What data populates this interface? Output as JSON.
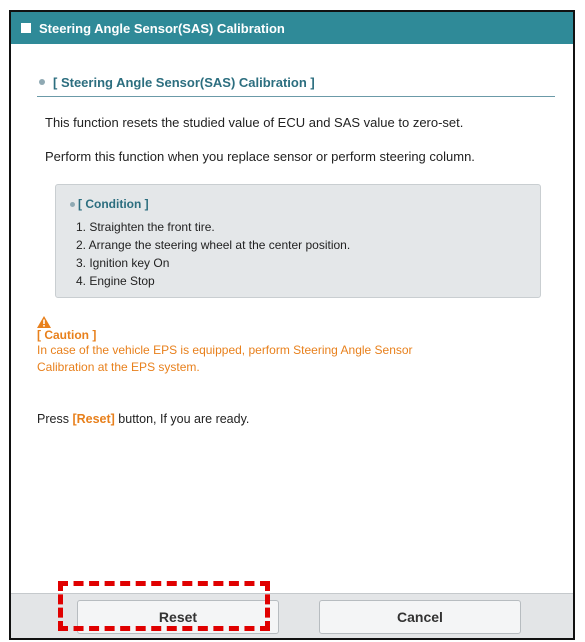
{
  "window": {
    "title": "Steering Angle Sensor(SAS) Calibration"
  },
  "section": {
    "header": "[ Steering Angle Sensor(SAS) Calibration ]",
    "desc1": "This function resets the studied value of ECU and SAS value to zero-set.",
    "desc2": "Perform this function when you replace sensor or perform steering column."
  },
  "condition": {
    "title": "[ Condition ]",
    "items": [
      "1. Straighten the front tire.",
      "2. Arrange the steering wheel at the center position.",
      "3. Ignition key On",
      "4. Engine Stop"
    ]
  },
  "caution": {
    "icon": "warning-icon",
    "title": "[ Caution ]",
    "text": "In case of the vehicle EPS is equipped, perform Steering Angle Sensor Calibration at the EPS system."
  },
  "instruction": {
    "prefix": "Press ",
    "keyword": "[Reset]",
    "suffix": " button, If you are ready."
  },
  "buttons": {
    "reset": "Reset",
    "cancel": "Cancel"
  },
  "colors": {
    "titlebar": "#2f8a98",
    "accent_text": "#2c6e7f",
    "caution": "#e8801c",
    "highlight": "#e00000"
  }
}
